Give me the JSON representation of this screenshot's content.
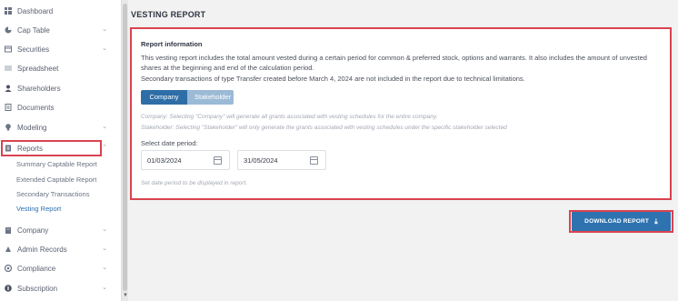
{
  "sidebar": {
    "items": [
      {
        "label": "Dashboard",
        "icon": "dashboard-icon",
        "chevron": ""
      },
      {
        "label": "Cap Table",
        "icon": "pie-chart-icon",
        "chevron": "⌄"
      },
      {
        "label": "Securities",
        "icon": "securities-icon",
        "chevron": "⌄"
      },
      {
        "label": "Spreadsheet",
        "icon": "spreadsheet-icon",
        "chevron": ""
      },
      {
        "label": "Shareholders",
        "icon": "users-icon",
        "chevron": ""
      },
      {
        "label": "Documents",
        "icon": "document-icon",
        "chevron": ""
      },
      {
        "label": "Modeling",
        "icon": "lightbulb-icon",
        "chevron": "⌄"
      },
      {
        "label": "Reports",
        "icon": "report-icon",
        "chevron": "⌃"
      },
      {
        "label": "Company",
        "icon": "building-icon",
        "chevron": "⌄"
      },
      {
        "label": "Admin Records",
        "icon": "admin-icon",
        "chevron": "⌄"
      },
      {
        "label": "Compliance",
        "icon": "compliance-icon",
        "chevron": "⌄"
      },
      {
        "label": "Subscription",
        "icon": "subscription-icon",
        "chevron": "⌄"
      }
    ],
    "reports_subitems": [
      "Summary Captable Report",
      "Extended Captable Report",
      "Secondary Transactions",
      "Vesting Report"
    ],
    "active_subitem": "Vesting Report"
  },
  "page": {
    "title": "VESTING REPORT"
  },
  "report_info": {
    "title": "Report information",
    "description": "This vesting report includes the total amount vested during a certain period for common & preferred stock, options and warrants. It also includes the amount of unvested shares at the beginning and end of the calculation period.",
    "limitation": "Secondary transactions of type Transfer created before March 4, 2024 are not included in the report due to technical limitations.",
    "toggle": {
      "option_1": "Company",
      "option_2": "Stakeholder",
      "selected": "Company"
    },
    "hint_company": "Company: Selecting \"Company\" will generate all grants associated with vesting schedules for the entire company.",
    "hint_stakeholder": "Stakeholder: Selecting \"Stakeholder\" will only generate the grants associated with vesting schedules under the specific stakeholder selected",
    "date_label": "Select date period:",
    "start_date": "01/03/2024",
    "end_date": "31/05/2024",
    "date_hint": "Set date period to be displayed in report."
  },
  "download": {
    "label": "DOWNLOAD REPORT",
    "icon": "download-icon"
  },
  "colors": {
    "highlight": "#d9434f",
    "primary": "#2e73b0",
    "toggle_off": "#9bbad6",
    "active_link": "#2a6fb0"
  }
}
